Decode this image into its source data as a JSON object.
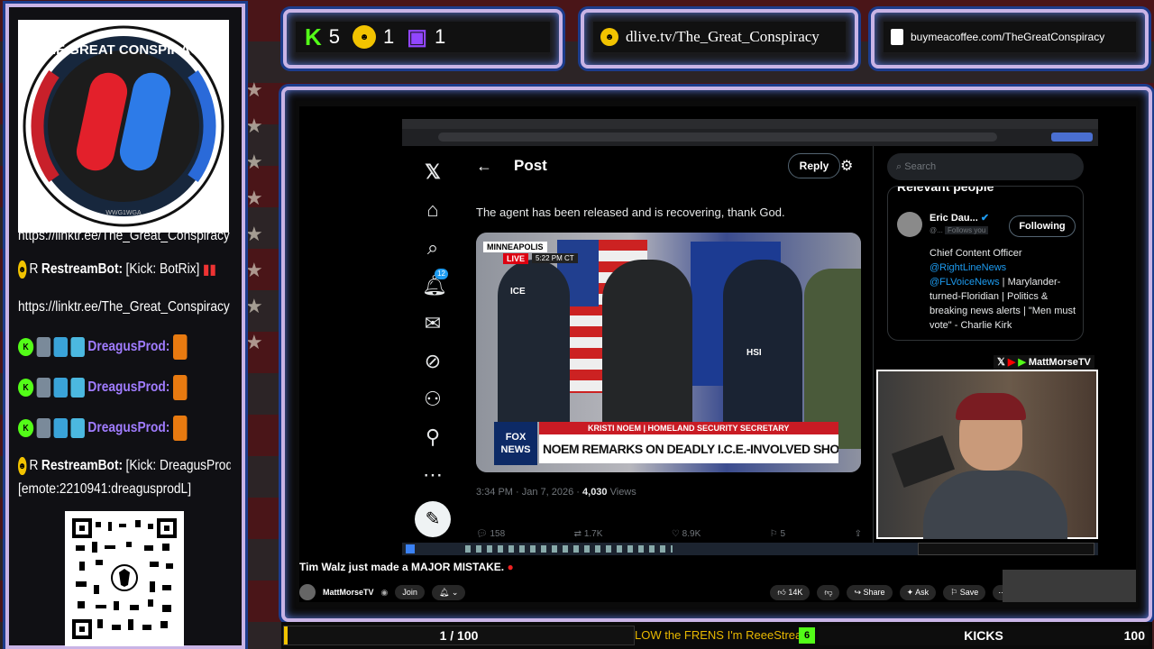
{
  "topbar": {
    "kick_count": "5",
    "dlive_count": "1",
    "twitch_count": "1",
    "dlive_url": "dlive.tv/The_Great_Conspiracy",
    "bmac_url": "buymeacoffee.com/TheGreatConspiracy"
  },
  "logo": {
    "top_text": "THE GREAT CONSPIRACY",
    "bottom_text": "WWG1WGA"
  },
  "chat": {
    "line1": "https://linktr.ee/The_Great_Conspiracy",
    "bot_name": "RestreamBot:",
    "bot_msg1": "[Kick: BotRix]",
    "line3": "https://linktr.ee/The_Great_Conspiracy",
    "user": "DreagusProd:",
    "bot_msg2": "[Kick: DreagusProd]",
    "emote_line": "[emote:2210941:dreagusprodL]",
    "badge_r": "R",
    "badge_k": "K"
  },
  "browser": {
    "post_title": "Post",
    "reply_label": "Reply",
    "search_placeholder": "Search",
    "tweet_text": "The agent has been released and is recovering, thank God.",
    "notif_count": "12",
    "tweet_meta": "3:34 PM · Jan 7, 2026 · ",
    "views_count": "4,030",
    "views_label": "Views",
    "replies": "158",
    "reposts": "1.7K",
    "likes": "8.9K",
    "bookmarks": "5",
    "relevant_heading": "Relevant people",
    "person_name": "Eric Dau...",
    "person_handle": "@...",
    "follows_you": "Follows you",
    "following_label": "Following",
    "bio_line1": "Chief Content Officer",
    "bio_mention1": "@RightLineNews",
    "bio_mention2": "@FLVoiceNews",
    "bio_rest": "| Marylander-turned-Floridian | Politics & breaking news alerts | \"Men must vote\" - Charlie Kirk",
    "news_location": "MINNEAPOLIS",
    "news_live": "LIVE",
    "news_time": "5:22 PM CT",
    "news_name_strip": "KRISTI NOEM | HOMELAND SECURITY SECRETARY",
    "news_headline": "NOEM REMARKS ON DEADLY I.C.E.-INVOLVED SHOOTING",
    "news_brand": "FOX NEWS",
    "news_ice": "ICE",
    "news_hsi": "HSI"
  },
  "webcam": {
    "channel_label": "MattMorseTV"
  },
  "youtube": {
    "video_title": "Tim Walz just made a MAJOR MISTAKE.",
    "channel": "MattMorseTV",
    "join_label": "Join",
    "likes": "14K",
    "share_label": "Share",
    "ask_label": "Ask",
    "save_label": "Save"
  },
  "bottom": {
    "goal_progress": "1 / 100",
    "goal_fraction": 0.01,
    "ticker": "LOW the FRENS I'm ReeeStreaming",
    "kicks_badge": "6",
    "kicks_label": "KICKS",
    "kicks_total": "100"
  },
  "colors": {
    "accent_frame": "#c9b4e6",
    "kick_green": "#53fc18",
    "twitch_purple": "#9146ff",
    "dlive_yellow": "#f2c300",
    "x_blue": "#1d9bf0"
  }
}
